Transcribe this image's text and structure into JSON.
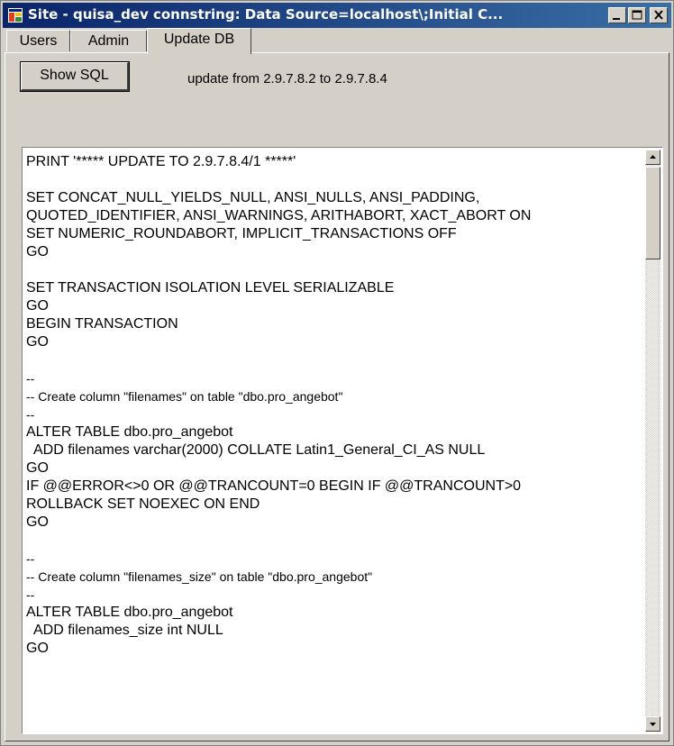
{
  "window": {
    "title": "Site - quisa_dev connstring: Data Source=localhost\\;Initial C..."
  },
  "tabs": [
    {
      "label": "Users"
    },
    {
      "label": "Admin"
    },
    {
      "label": "Update DB"
    }
  ],
  "active_tab": "Update DB",
  "toolbar": {
    "show_sql_label": "Show SQL",
    "status": "update from 2.9.7.8.2 to 2.9.7.8.4"
  },
  "sql_lines": [
    "PRINT '***** UPDATE TO 2.9.7.8.4/1 *****'",
    "",
    "SET CONCAT_NULL_YIELDS_NULL, ANSI_NULLS, ANSI_PADDING,",
    "QUOTED_IDENTIFIER, ANSI_WARNINGS, ARITHABORT, XACT_ABORT ON",
    "SET NUMERIC_ROUNDABORT, IMPLICIT_TRANSACTIONS OFF",
    "GO",
    "",
    "SET TRANSACTION ISOLATION LEVEL SERIALIZABLE",
    "GO",
    "BEGIN TRANSACTION",
    "GO",
    "",
    "--",
    "-- Create column \"filenames\" on table \"dbo.pro_angebot\"",
    "--",
    "ALTER TABLE dbo.pro_angebot",
    "  ADD filenames varchar(2000) COLLATE Latin1_General_CI_AS NULL",
    "GO",
    "IF @@ERROR<>0 OR @@TRANCOUNT=0 BEGIN IF @@TRANCOUNT>0",
    "ROLLBACK SET NOEXEC ON END",
    "GO",
    "",
    "--",
    "-- Create column \"filenames_size\" on table \"dbo.pro_angebot\"",
    "--",
    "ALTER TABLE dbo.pro_angebot",
    "  ADD filenames_size int NULL",
    "GO"
  ],
  "scrollbar": {
    "position": 0.0
  },
  "icons": {
    "app": "app-icon",
    "minimize": "minimize-icon",
    "maximize": "maximize-icon",
    "close": "close-icon",
    "scroll_up": "scroll-up-icon",
    "scroll_down": "scroll-down-icon"
  },
  "colors": {
    "titlebar_start": "#0a246a",
    "titlebar_end": "#3a6ea5",
    "face": "#d4d0c8"
  }
}
